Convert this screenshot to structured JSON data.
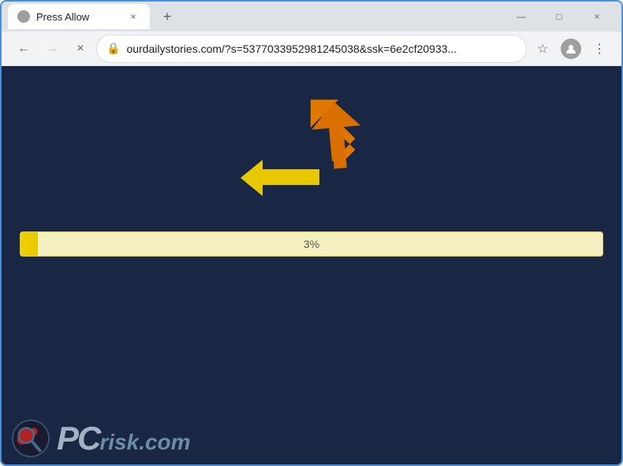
{
  "browser": {
    "title": "Press Allow",
    "tab": {
      "favicon_label": "🌐",
      "title": "Press Allow",
      "close_label": "×"
    },
    "new_tab_label": "+",
    "window_controls": {
      "minimize": "—",
      "maximize": "□",
      "close": "×"
    },
    "nav": {
      "back_label": "←",
      "forward_label": "→",
      "reload_label": "×",
      "lock_label": "🔒",
      "url": "ourdailystories.com/?s=5377033952981245038&ssk=6e2cf20933...",
      "star_label": "☆",
      "profile_label": "👤",
      "menu_label": "⋮"
    }
  },
  "page": {
    "progress_percent": 3,
    "progress_label": "3%",
    "progress_fill_width": "3%"
  },
  "watermark": {
    "logo_label": "PC",
    "text_pc": "PC",
    "text_risk": "risk",
    "text_dot": ".",
    "text_com": "com"
  },
  "arrows": {
    "orange_arrow_label": "orange-up-arrow",
    "yellow_arrow_label": "yellow-left-arrow"
  }
}
